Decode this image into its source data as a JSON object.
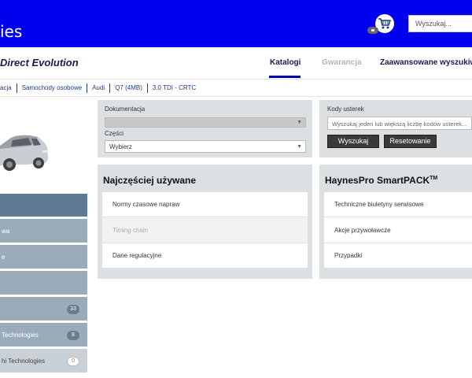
{
  "header": {
    "brand": "ies",
    "search_placeholder": "Wyszukaj..."
  },
  "app_title": "Direct Evolution",
  "nav": {
    "tabs": [
      {
        "label": "Katalogi",
        "active": true
      },
      {
        "label": "Gwarancja",
        "active": false
      },
      {
        "label": "Zaawansowane wyszukiw",
        "active": false
      }
    ]
  },
  "breadcrumb": [
    "acja",
    "Samochody osobowe",
    "Audi",
    "Q7 (4MB)",
    "3.0 TDI - CRTC"
  ],
  "sidebar": {
    "items": [
      {
        "label": "",
        "badge": ""
      },
      {
        "label": "wa",
        "badge": ""
      },
      {
        "label": "e",
        "badge": ""
      },
      {
        "label": "",
        "badge": ""
      },
      {
        "label": "",
        "badge": "33"
      },
      {
        "label": "Technologies",
        "badge": "8"
      },
      {
        "label": "hi Technologies",
        "badge": "0"
      }
    ]
  },
  "left_form": {
    "doc_label": "Dokumentacja",
    "parts_label": "Części",
    "parts_value": "Wybierz"
  },
  "right_form": {
    "codes_label": "Kody usterek",
    "codes_placeholder": "Wyszukaj jeden lub większą liczbę kodów usterek...",
    "search_button": "Wyszukaj",
    "reset_button": "Resetowanie"
  },
  "most_used": {
    "title": "Najczęściej używane",
    "items": [
      "Normy czasowe napraw",
      "Timing chain",
      "Dane regulacyjne"
    ]
  },
  "smartpack": {
    "title": "HaynesPro SmartPACK",
    "title_sup": "TM",
    "items": [
      "Techniczne biuletyny serwisowe",
      "Akcje przywoławcze",
      "Przypadki"
    ]
  },
  "colors": {
    "header_bg": "#0000ee",
    "sidebar_active": "#5f7a94",
    "sidebar_item": "#9aacbc",
    "panel_bg": "#dde0e3"
  }
}
